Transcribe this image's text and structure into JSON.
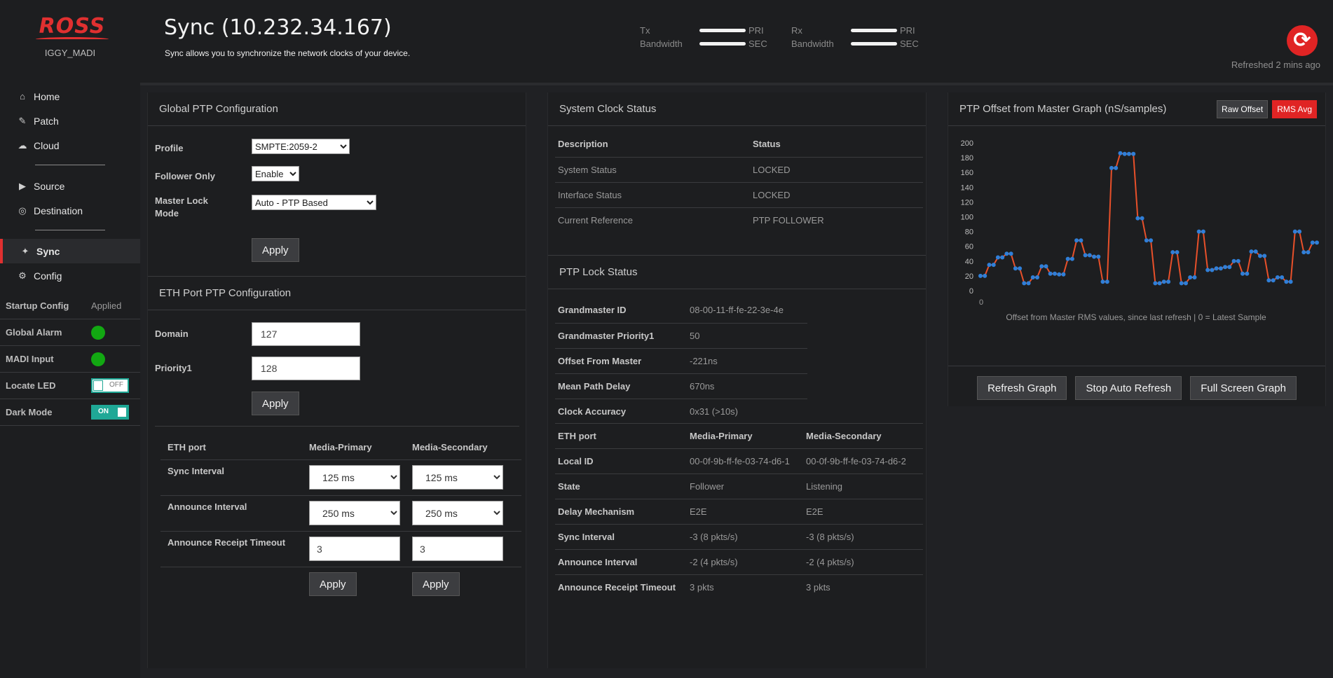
{
  "brand": {
    "logo": "ROSS",
    "device": "IGGY_MADI"
  },
  "nav": {
    "items": [
      {
        "label": "Home",
        "icon": "home-icon",
        "glyph": "⌂"
      },
      {
        "label": "Patch",
        "icon": "edit-icon",
        "glyph": "✎"
      },
      {
        "label": "Cloud",
        "icon": "cloud-icon",
        "glyph": "☁"
      },
      {
        "label": "Source",
        "icon": "source-icon",
        "glyph": "▶"
      },
      {
        "label": "Destination",
        "icon": "destination-icon",
        "glyph": "◎"
      },
      {
        "label": "Sync",
        "icon": "sync-nav-icon",
        "glyph": "✦"
      },
      {
        "label": "Config",
        "icon": "config-icon",
        "glyph": "⚙"
      }
    ]
  },
  "status": {
    "startup_label": "Startup Config",
    "startup_value": "Applied",
    "alarm_label": "Global Alarm",
    "madi_label": "MADI Input",
    "locate_label": "Locate LED",
    "locate_state": "OFF",
    "dark_label": "Dark Mode",
    "dark_state": "ON",
    "ok_color": "#12a812"
  },
  "header": {
    "title": "Sync (10.232.34.167)",
    "subtitle": "Sync allows you to synchronize the network clocks of your device.",
    "tx_label1": "Tx",
    "tx_label2": "Bandwidth",
    "rx_label1": "Rx",
    "rx_label2": "Bandwidth",
    "pri": "PRI",
    "sec": "SEC",
    "refreshed": "Refreshed 2 mins ago"
  },
  "global_ptp": {
    "title": "Global PTP Configuration",
    "profile_label": "Profile",
    "profile_value": "SMPTE:2059-2",
    "follower_label": "Follower Only",
    "follower_value": "Enable",
    "master_lock_label1": "Master Lock",
    "master_lock_label2": "Mode",
    "master_lock_value": "Auto - PTP Based",
    "apply": "Apply"
  },
  "eth_ptp": {
    "title": "ETH Port PTP Configuration",
    "domain_label": "Domain",
    "domain_value": "127",
    "priority_label": "Priority1",
    "priority_value": "128",
    "apply": "Apply",
    "table": {
      "headers": [
        "ETH port",
        "Media-Primary",
        "Media-Secondary"
      ],
      "sync_label": "Sync Interval",
      "sync_primary": "125 ms",
      "sync_secondary": "125 ms",
      "announce_label": "Announce Interval",
      "announce_primary": "250 ms",
      "announce_secondary": "250 ms",
      "timeout_label": "Announce Receipt Timeout",
      "timeout_primary": "3",
      "timeout_secondary": "3",
      "apply": "Apply"
    }
  },
  "system_clock": {
    "title": "System Clock Status",
    "headers": [
      "Description",
      "Status"
    ],
    "rows": [
      [
        "System Status",
        "LOCKED"
      ],
      [
        "Interface Status",
        "LOCKED"
      ],
      [
        "Current Reference",
        "PTP FOLLOWER"
      ]
    ]
  },
  "ptp_lock": {
    "title": "PTP Lock Status",
    "rows": [
      [
        "Grandmaster ID",
        "08-00-11-ff-fe-22-3e-4e"
      ],
      [
        "Grandmaster Priority1",
        "50"
      ],
      [
        "Offset From Master",
        "-221ns"
      ],
      [
        "Mean Path Delay",
        "670ns"
      ],
      [
        "Clock Accuracy",
        "0x31 (>10s)"
      ]
    ],
    "port_headers": [
      "ETH port",
      "Media-Primary",
      "Media-Secondary"
    ],
    "port_rows": [
      [
        "Local ID",
        "00-0f-9b-ff-fe-03-74-d6-1",
        "00-0f-9b-ff-fe-03-74-d6-2"
      ],
      [
        "State",
        "Follower",
        "Listening"
      ],
      [
        "Delay Mechanism",
        "E2E",
        "E2E"
      ],
      [
        "Sync Interval",
        "-3 (8 pkts/s)",
        "-3 (8 pkts/s)"
      ],
      [
        "Announce Interval",
        "-2 (4 pkts/s)",
        "-2 (4 pkts/s)"
      ],
      [
        "Announce Receipt Timeout",
        "3 pkts",
        "3 pkts"
      ]
    ]
  },
  "graph": {
    "title": "PTP Offset from Master Graph (nS/samples)",
    "raw_offset": "Raw Offset",
    "rms_avg": "RMS Avg",
    "caption": "Offset from Master RMS values, since last refresh  |  0 = Latest Sample",
    "refresh": "Refresh Graph",
    "stop": "Stop Auto Refresh",
    "fullscreen": "Full Screen Graph",
    "accent": "#e02424"
  },
  "chart_data": {
    "type": "line",
    "title": "",
    "xlabel": "",
    "ylabel": "",
    "x_tick_labels": [
      "0"
    ],
    "yticks": [
      200,
      180,
      160,
      140,
      120,
      100,
      80,
      60,
      40,
      20,
      0
    ],
    "ylim": [
      0,
      200
    ],
    "series": [
      {
        "line_color": "#e8502a",
        "point_color": "#2f7fd8",
        "values": [
          20,
          20,
          35,
          35,
          45,
          45,
          50,
          50,
          30,
          30,
          10,
          10,
          18,
          18,
          33,
          33,
          23,
          23,
          22,
          22,
          43,
          43,
          68,
          68,
          48,
          48,
          46,
          46,
          12,
          12,
          166,
          166,
          186,
          185,
          185,
          185,
          98,
          98,
          68,
          68,
          10,
          10,
          12,
          12,
          52,
          52,
          10,
          10,
          18,
          18,
          80,
          80,
          28,
          28,
          30,
          30,
          32,
          32,
          40,
          40,
          23,
          23,
          53,
          53,
          47,
          47,
          14,
          14,
          18,
          18,
          12,
          12,
          80,
          80,
          52,
          52,
          65,
          65
        ]
      }
    ]
  }
}
